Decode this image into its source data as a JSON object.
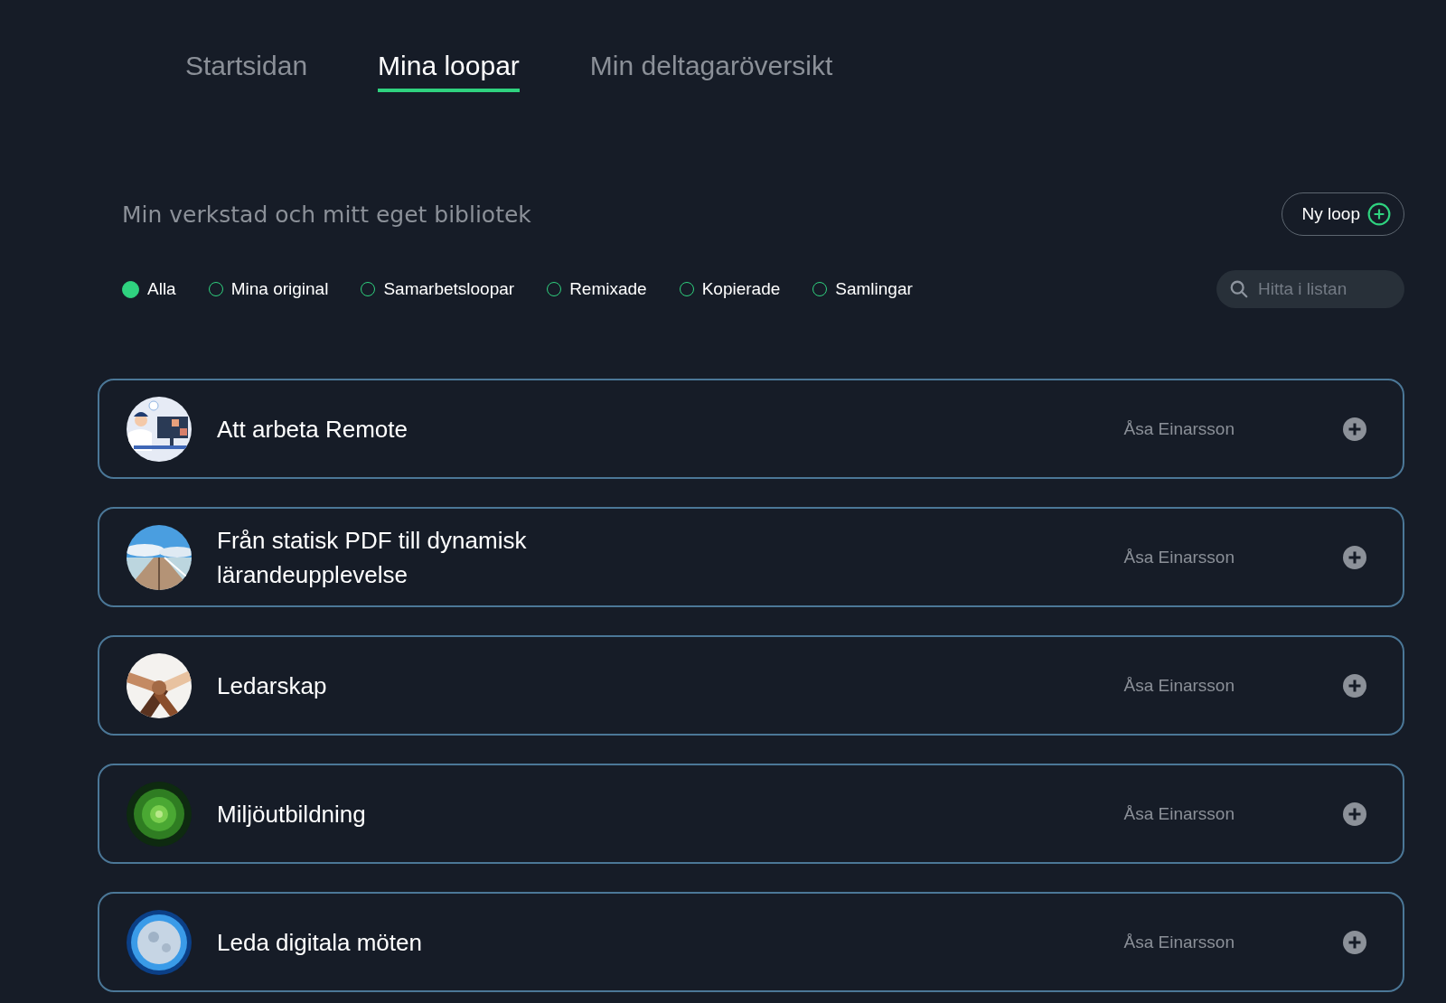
{
  "tabs": [
    {
      "label": "Startsidan",
      "selected": false
    },
    {
      "label": "Mina loopar",
      "selected": true
    },
    {
      "label": "Min deltagaröversikt",
      "selected": false
    }
  ],
  "library": {
    "heading": "Min verkstad och mitt eget bibliotek",
    "new_button": "Ny loop",
    "filters": [
      {
        "label": "Alla",
        "selected": true
      },
      {
        "label": "Mina original",
        "selected": false
      },
      {
        "label": "Samarbetsloopar",
        "selected": false
      },
      {
        "label": "Remixade",
        "selected": false
      },
      {
        "label": "Kopierade",
        "selected": false
      },
      {
        "label": "Samlingar",
        "selected": false
      }
    ],
    "search": {
      "placeholder": "Hitta i listan"
    }
  },
  "loops": [
    {
      "title": "Att arbeta Remote",
      "author": "Åsa Einarsson"
    },
    {
      "title": "Från statisk PDF till dynamisk lärandeupplevelse",
      "author": "Åsa Einarsson"
    },
    {
      "title": "Ledarskap",
      "author": "Åsa Einarsson"
    },
    {
      "title": "Miljöutbildning",
      "author": "Åsa Einarsson"
    },
    {
      "title": "Leda digitala möten",
      "author": "Åsa Einarsson"
    }
  ]
}
